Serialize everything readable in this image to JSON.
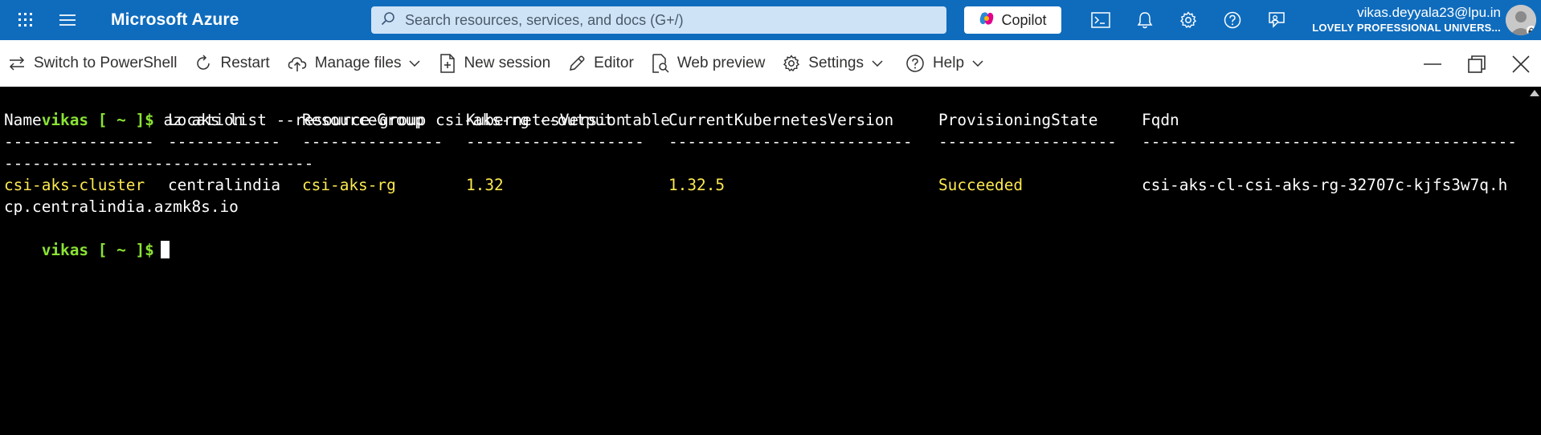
{
  "topbar": {
    "brand": "Microsoft Azure",
    "search_placeholder": "Search resources, services, and docs (G+/)",
    "copilot_label": "Copilot",
    "icons": [
      "waffle-icon",
      "hamburger-menu-icon",
      "cloud-shell-icon",
      "bell-icon",
      "gear-icon",
      "help-icon",
      "feedback-icon"
    ],
    "account_email": "vikas.deyyala23@lpu.in",
    "account_org": "LOVELY PROFESSIONAL UNIVERS..."
  },
  "toolbar": {
    "items": [
      {
        "label": "Switch to PowerShell",
        "icon": "switch-arrows-icon"
      },
      {
        "label": "Restart",
        "icon": "restart-icon"
      },
      {
        "label": "Manage files",
        "icon": "cloud-upload-icon",
        "dropdown": true
      },
      {
        "label": "New session",
        "icon": "new-session-icon"
      },
      {
        "label": "Editor",
        "icon": "pencil-icon"
      },
      {
        "label": "Web preview",
        "icon": "web-preview-icon"
      },
      {
        "label": "Settings",
        "icon": "gear-icon",
        "dropdown": true
      },
      {
        "label": "Help",
        "icon": "help-icon",
        "dropdown": true
      }
    ],
    "window_controls": [
      "minimize-icon",
      "restore-icon",
      "close-icon"
    ]
  },
  "terminal": {
    "prompt": "vikas [ ~ ]$",
    "command": "az aks list --resource-group csi-aks-rg --output table",
    "headers": [
      "Name",
      "Location",
      "ResourceGroup",
      "KubernetesVersion",
      "CurrentKubernetesVersion",
      "ProvisioningState",
      "Fqdn"
    ],
    "dashes": [
      "----------------",
      "------------",
      "---------------",
      "-------------------",
      "--------------------------",
      "-------------------",
      "-------------------------------------------------------------------------"
    ],
    "row": [
      "csi-aks-cluster",
      "centralindia",
      "csi-aks-rg",
      "1.32",
      "1.32.5",
      "Succeeded",
      "csi-aks-cl-csi-aks-rg-32707c-kjfs3w7q.hcp.centralindia.azmk8s.io"
    ],
    "fqdn_line1": "csi-aks-cl-csi-aks-rg-32707c-kjfs3w7q.h",
    "fqdn_line2": "cp.centralindia.azmk8s.io",
    "colors": {
      "prompt": "#8ae234",
      "highlight": "#fce94f",
      "text": "#ffffff",
      "background": "#000000"
    }
  }
}
